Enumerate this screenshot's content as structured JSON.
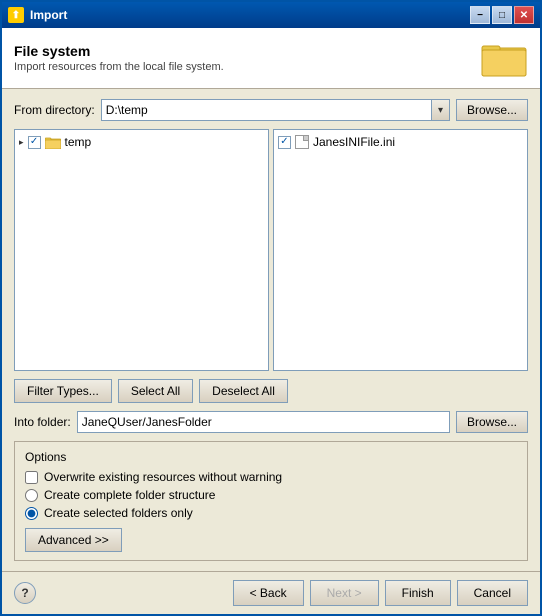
{
  "window": {
    "title": "Import",
    "title_icon": "📦"
  },
  "title_buttons": {
    "minimize": "−",
    "maximize": "□",
    "close": "✕"
  },
  "header": {
    "title": "File system",
    "description": "Import resources from the local file system."
  },
  "from_directory": {
    "label": "From directory:",
    "value": "D:\\temp",
    "placeholder": "D:\\temp",
    "browse_label": "Browse..."
  },
  "left_panel": {
    "items": [
      {
        "label": "temp",
        "type": "folder",
        "checked": true,
        "level": 0
      }
    ]
  },
  "right_panel": {
    "items": [
      {
        "label": "JanesINIFile.ini",
        "type": "file",
        "checked": true,
        "level": 0
      }
    ]
  },
  "panel_buttons": {
    "filter_types": "Filter Types...",
    "select_all": "Select All",
    "deselect_all": "Deselect All"
  },
  "into_folder": {
    "label": "Into folder:",
    "value": "JaneQUser/JanesFolder",
    "browse_label": "Browse..."
  },
  "options": {
    "title": "Options",
    "overwrite": {
      "label": "Overwrite existing resources without warning",
      "checked": false
    },
    "complete_folder": {
      "label": "Create complete folder structure",
      "checked": false
    },
    "selected_folders": {
      "label": "Create selected folders only",
      "checked": true
    },
    "advanced_label": "Advanced >>"
  },
  "footer": {
    "help": "?",
    "back": "< Back",
    "next": "Next >",
    "finish": "Finish",
    "cancel": "Cancel"
  }
}
